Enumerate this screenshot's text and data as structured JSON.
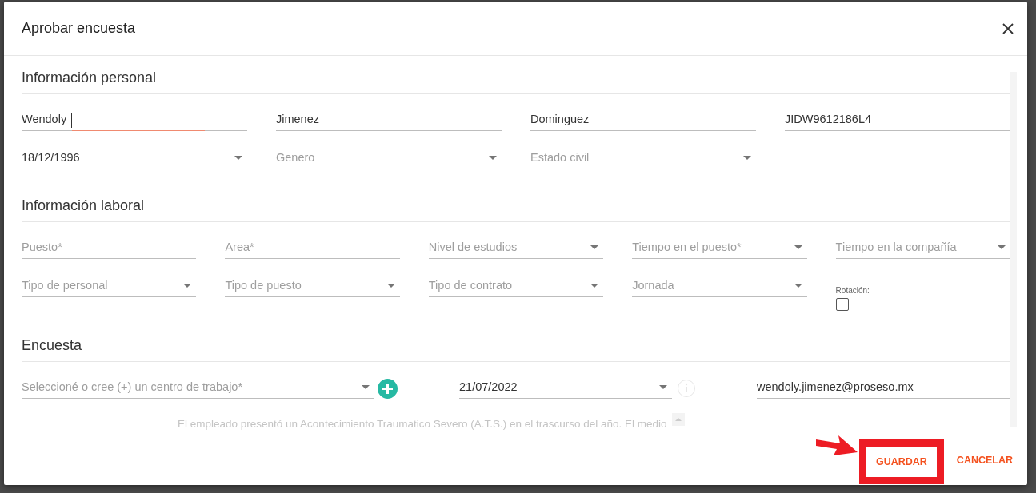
{
  "dialog": {
    "title": "Aprobar encuesta"
  },
  "sections": [
    {
      "title": "Información personal",
      "rows": [
        [
          {
            "kind": "text",
            "value": "Wendoly",
            "focused": true
          },
          {
            "kind": "text",
            "value": "Jimenez"
          },
          {
            "kind": "text",
            "value": "Dominguez"
          },
          {
            "kind": "text",
            "value": "JIDW9612186L4"
          }
        ],
        [
          {
            "kind": "select",
            "value": "18/12/1996"
          },
          {
            "kind": "select",
            "placeholder": "Genero"
          },
          {
            "kind": "select",
            "placeholder": "Estado civil"
          }
        ]
      ]
    },
    {
      "title": "Información laboral",
      "rows": [
        [
          {
            "kind": "text",
            "placeholder": "Puesto*"
          },
          {
            "kind": "text",
            "placeholder": "Area*"
          },
          {
            "kind": "select",
            "placeholder": "Nivel de estudios"
          },
          {
            "kind": "select",
            "placeholder": "Tiempo en el puesto*"
          },
          {
            "kind": "select",
            "placeholder": "Tiempo en la compañía"
          }
        ],
        [
          {
            "kind": "select",
            "placeholder": "Tipo de personal"
          },
          {
            "kind": "select",
            "placeholder": "Tipo de puesto"
          },
          {
            "kind": "select",
            "placeholder": "Tipo de contrato"
          },
          {
            "kind": "select",
            "placeholder": "Jornada"
          },
          {
            "kind": "checkbox",
            "label": "Rotación:",
            "checked": false
          }
        ]
      ]
    },
    {
      "title": "Encuesta",
      "rows": [
        [
          {
            "kind": "select",
            "placeholder": "Seleccioné o cree (+) un centro de trabajo*",
            "add_button": true
          },
          {
            "kind": "select",
            "value": "21/07/2022",
            "info": true
          },
          {
            "kind": "text",
            "value": "wendoly.jimenez@proseso.mx"
          }
        ]
      ]
    }
  ],
  "note": "El empleado presentó un Acontecimiento Traumatico Severo (A.T.S.) en el trascurso del año. El medio",
  "buttons": [
    {
      "label": "GUARDAR",
      "highlighted": true
    },
    {
      "label": "CANCELAR",
      "highlighted": false
    }
  ]
}
